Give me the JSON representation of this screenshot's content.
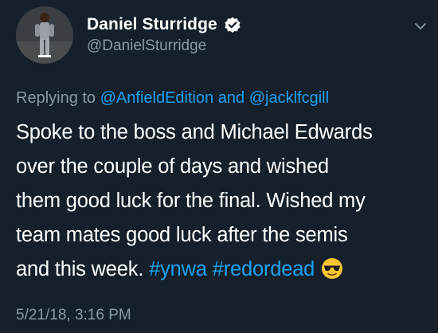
{
  "author": {
    "display_name": "Daniel Sturridge",
    "handle": "@DanielSturridge",
    "verified": true,
    "avatar_icon": "avatar-photo"
  },
  "menu": {
    "icon": "chevron-down-icon"
  },
  "reply": {
    "prefix": "Replying to ",
    "mention_1": "@AnfieldEdition",
    "joiner": " and ",
    "mention_2": "@jacklfcgill"
  },
  "tweet": {
    "lines": [
      "Spoke to the boss and Michael Edwards",
      "over the couple of days and wished",
      "them good luck for the final. Wished my",
      "team mates good luck after the semis"
    ],
    "last_line_text": "and this week. ",
    "hashtag_1": "#ynwa",
    "hashtag_2": "#redordead",
    "emoji": "smiling-face-with-sunglasses-icon"
  },
  "timestamp": "5/21/18, 3:16 PM",
  "colors": {
    "background": "#15202b",
    "primary_text": "#ffffff",
    "secondary_text": "#8899a6",
    "link": "#1da1f2"
  }
}
